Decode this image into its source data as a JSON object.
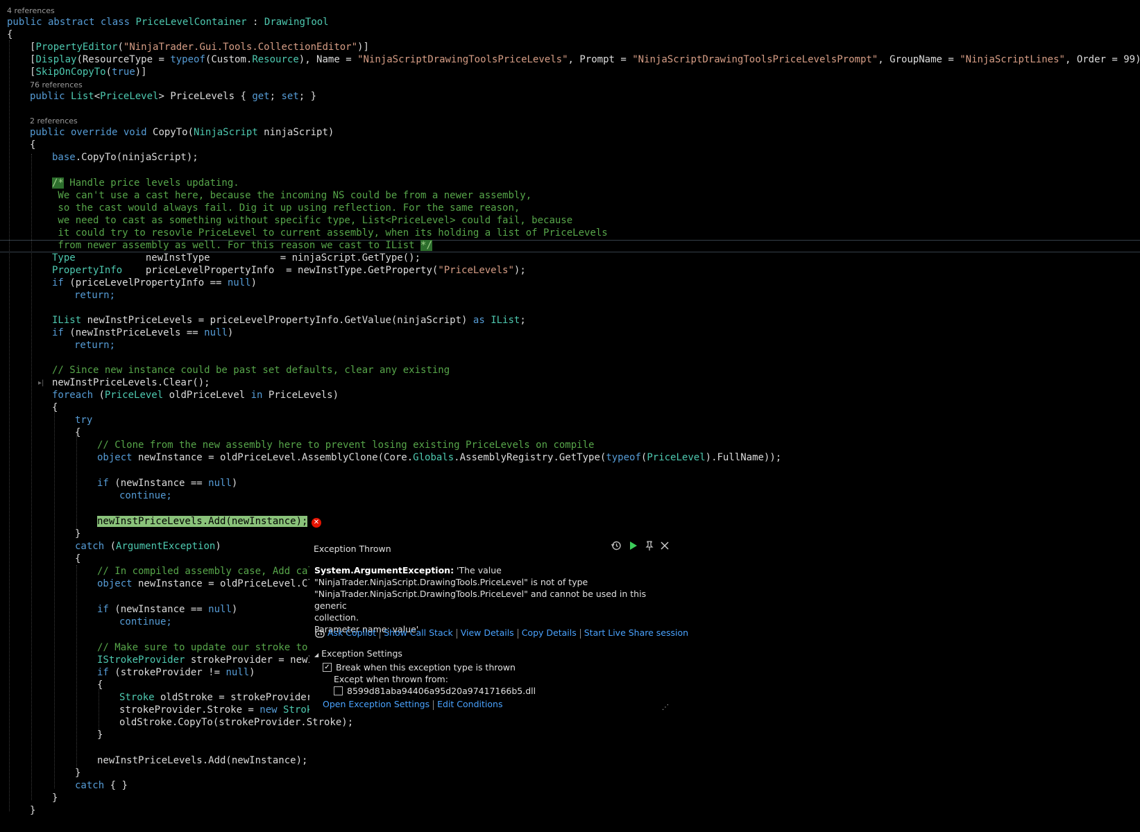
{
  "code": {
    "refs_4": "4 references",
    "refs_76": "76 references",
    "refs_2": "2 references",
    "class_decl": [
      "public abstract class ",
      "PriceLevelContainer",
      " : ",
      "DrawingTool"
    ],
    "open_brace": "{",
    "close_brace": "}",
    "attr1": [
      "[",
      "PropertyEditor",
      "(",
      "\"NinjaTrader.Gui.Tools.CollectionEditor\"",
      ")]"
    ],
    "attr2": [
      "[",
      "Display",
      "(ResourceType = ",
      "typeof",
      "(Custom.",
      "Resource",
      "), Name = ",
      "\"NinjaScriptDrawingToolsPriceLevels\"",
      ", Prompt = ",
      "\"NinjaScriptDrawingToolsPriceLevelsPrompt\"",
      ", GroupName = ",
      "\"NinjaScriptLines\"",
      ", Order = 99)]"
    ],
    "attr3": [
      "[",
      "SkipOnCopyTo",
      "(",
      "true",
      ")]"
    ],
    "prop_decl": [
      "public ",
      "List",
      "<",
      "PriceLevel",
      "> PriceLevels { ",
      "get",
      "; ",
      "set",
      "; }"
    ],
    "method_decl": [
      "public override void ",
      "CopyTo(",
      "NinjaScript",
      " ninjaScript)"
    ],
    "base_call": [
      "base",
      ".CopyTo(ninjaScript);"
    ],
    "comment_block": [
      "/* Handle price levels updating.",
      " We can't use a cast here, because the incoming NS could be from a newer assembly,",
      " so the cast would always fail. Dig it up using reflection. For the same reason,",
      " we need to cast as something without specific type, List<PriceLevel> could fail, because",
      " it could try to resovle PriceLevel to current assembly, when its holding a list of PriceLevels",
      " from newer assembly as well. For this reason we cast to IList */"
    ],
    "type_line": [
      "Type",
      "            newInstType            = ninjaScript.GetType();"
    ],
    "propinfo_line": [
      "PropertyInfo",
      "    priceLevelPropertyInfo  = newInstType.GetProperty(",
      "\"PriceLevels\"",
      ");"
    ],
    "if_null_1": [
      "if",
      " (priceLevelPropertyInfo == ",
      "null",
      ")"
    ],
    "return": "return;",
    "ilist_line": [
      "IList",
      " newInstPriceLevels = priceLevelPropertyInfo.GetValue(ninjaScript) ",
      "as",
      " ",
      "IList",
      ";"
    ],
    "if_null_2": [
      "if",
      " (newInstPriceLevels == ",
      "null",
      ")"
    ],
    "comment_clear": "// Since new instance could be past set defaults, clear any existing",
    "clear_call": "newInstPriceLevels.Clear();",
    "foreach_line": [
      "foreach",
      " (",
      "PriceLevel",
      " oldPriceLevel ",
      "in",
      " PriceLevels)"
    ],
    "try": "try",
    "comment_clone": "// Clone from the new assembly here to prevent losing existing PriceLevels on compile",
    "object_line": [
      "object",
      " newInstance = oldPriceLevel.AssemblyClone(Core.",
      "Globals",
      ".AssemblyRegistry.GetType(",
      "typeof",
      "(",
      "PriceLevel",
      ").FullName));"
    ],
    "if_newinst": [
      "if",
      " (newInstance == ",
      "null",
      ")"
    ],
    "continue": "continue;",
    "add_call": "newInstPriceLevels.Add(newInstance);",
    "catch_arg": [
      "catch",
      " (",
      "ArgumentException",
      ")"
    ],
    "comment_compiled": "// In compiled assembly case, Add cal",
    "object_line2": [
      "object",
      " newInstance = oldPriceLevel.Cl"
    ],
    "comment_stroke": "// Make sure to update our stroke to ",
    "istroke_line": [
      "IStrokeProvider",
      " strokeProvider = newI"
    ],
    "if_stroke": [
      "if",
      " (strokeProvider != ",
      "null",
      ")"
    ],
    "stroke_line": [
      "Stroke",
      " oldStroke = strokeProvider"
    ],
    "stroke_assign": [
      "strokeProvider.Stroke = ",
      "new",
      " ",
      "Strok"
    ],
    "copyto_stroke": "oldStroke.CopyTo(strokeProvider.Stroke);",
    "catch_empty": [
      "catch",
      " { }"
    ]
  },
  "exception_popup": {
    "title": "Exception Thrown",
    "exception_type": "System.ArgumentException:",
    "message_lines": [
      " 'The value",
      "\"NinjaTrader.NinjaScript.DrawingTools.PriceLevel\" is not of type",
      "\"NinjaTrader.NinjaScript.DrawingTools.PriceLevel\" and cannot be used in this generic",
      "collection.",
      "Parameter name: value'"
    ],
    "links": {
      "ask_copilot": "Ask Copilot",
      "show_call_stack": "Show Call Stack",
      "view_details": "View Details",
      "copy_details": "Copy Details",
      "live_share": "Start Live Share session"
    },
    "settings": {
      "header": "Exception Settings",
      "break_when_thrown": "Break when this exception type is thrown",
      "break_checked": true,
      "except_when_from": "Except when thrown from:",
      "dll_name": "8599d81aba94406a95d20a97417166b5.dll",
      "dll_checked": false,
      "open_settings": "Open Exception Settings",
      "edit_conditions": "Edit Conditions"
    },
    "icons": [
      "history-icon",
      "continue-icon",
      "pin-icon",
      "close-icon"
    ]
  }
}
